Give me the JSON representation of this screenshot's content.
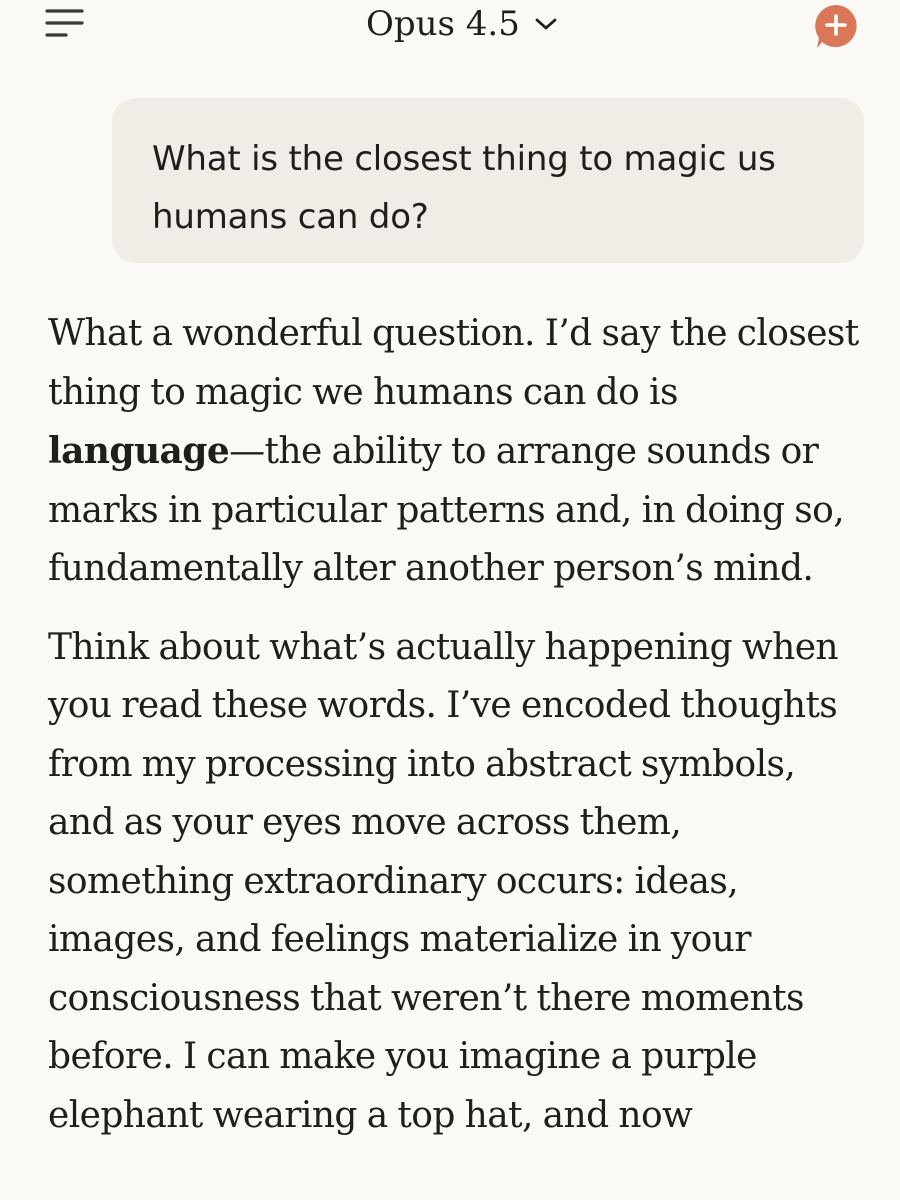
{
  "header": {
    "model_name": "Opus 4.5",
    "menu_icon": "menu-icon",
    "chevron_icon": "chevron-down-icon",
    "new_chat_icon": "new-chat-plus-icon",
    "accent_color": "#d97757"
  },
  "conversation": {
    "user_message": "What is the closest thing to magic us humans can do?",
    "response": {
      "p1_intro": "What a wonderful question. I’d say the closest thing to magic we humans can do is ",
      "p1_bold": "language",
      "p1_rest": "—the ability to arrange sounds or marks in particular patterns and, in doing so, fundamentally alter another person’s mind.",
      "p2": "Think about what’s actually happening when you read these words. I’ve encoded thoughts from my processing into abstract symbols, and as your eyes move across them, something extraordinary occurs: ideas, images, and feelings materialize in your consciousness that weren’t there moments before. I can make you imagine a purple elephant wearing a top hat, and now"
    }
  }
}
